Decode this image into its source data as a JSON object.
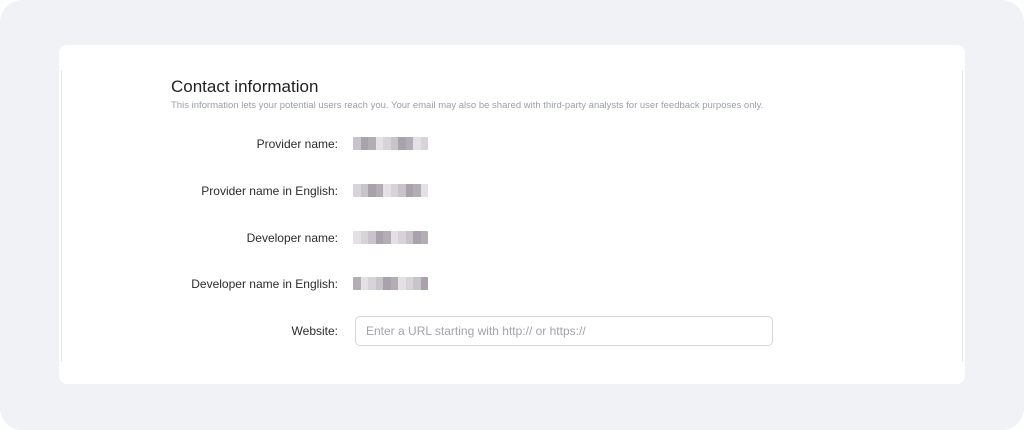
{
  "section": {
    "title": "Contact information",
    "description": "This information lets your potential users reach you. Your email may also be shared with third-party analysts for user feedback purposes only."
  },
  "fields": {
    "provider_name": {
      "label": "Provider name:"
    },
    "provider_name_en": {
      "label": "Provider name in English:"
    },
    "developer_name": {
      "label": "Developer name:"
    },
    "developer_name_en": {
      "label": "Developer name in English:"
    },
    "website": {
      "label": "Website:",
      "value": "",
      "placeholder": "Enter a URL starting with http:// or https://"
    }
  },
  "colors": {
    "page_background": "#f1f2f6",
    "card_background": "#ffffff",
    "input_border": "#d4d6dc",
    "redaction_palette": [
      "#c9c4cb",
      "#b3adb5",
      "#d8d3d9",
      "#a9a2ac",
      "#e4e0e5"
    ]
  }
}
